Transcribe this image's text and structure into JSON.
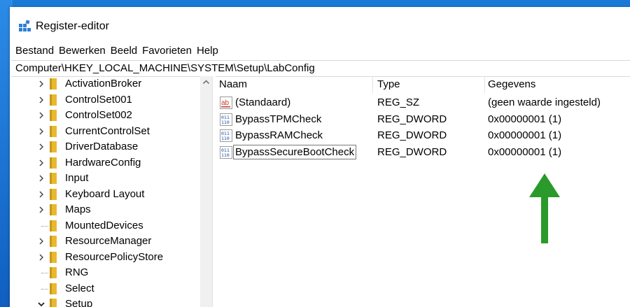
{
  "window": {
    "title": "Register-editor"
  },
  "menu": [
    "Bestand",
    "Bewerken",
    "Beeld",
    "Favorieten",
    "Help"
  ],
  "address": "Computer\\HKEY_LOCAL_MACHINE\\SYSTEM\\Setup\\LabConfig",
  "tree": [
    {
      "label": "ActivationBroker",
      "arrow": "right"
    },
    {
      "label": "ControlSet001",
      "arrow": "right"
    },
    {
      "label": "ControlSet002",
      "arrow": "right"
    },
    {
      "label": "CurrentControlSet",
      "arrow": "right"
    },
    {
      "label": "DriverDatabase",
      "arrow": "right"
    },
    {
      "label": "HardwareConfig",
      "arrow": "right"
    },
    {
      "label": "Input",
      "arrow": "right"
    },
    {
      "label": "Keyboard Layout",
      "arrow": "right"
    },
    {
      "label": "Maps",
      "arrow": "right"
    },
    {
      "label": "MountedDevices",
      "arrow": "none"
    },
    {
      "label": "ResourceManager",
      "arrow": "right"
    },
    {
      "label": "ResourcePolicyStore",
      "arrow": "right"
    },
    {
      "label": "RNG",
      "arrow": "none"
    },
    {
      "label": "Select",
      "arrow": "none"
    },
    {
      "label": "Setup",
      "arrow": "down"
    }
  ],
  "columns": {
    "name": "Naam",
    "type": "Type",
    "data": "Gegevens"
  },
  "values": [
    {
      "icon": "string-value-icon",
      "name": "(Standaard)",
      "type": "REG_SZ",
      "data": "(geen waarde ingesteld)"
    },
    {
      "icon": "binary-value-icon",
      "name": "BypassTPMCheck",
      "type": "REG_DWORD",
      "data": "0x00000001 (1)"
    },
    {
      "icon": "binary-value-icon",
      "name": "BypassRAMCheck",
      "type": "REG_DWORD",
      "data": "0x00000001 (1)"
    },
    {
      "icon": "binary-value-icon",
      "name": "BypassSecureBootCheck",
      "type": "REG_DWORD",
      "data": "0x00000001 (1)",
      "focused": true
    }
  ],
  "colors": {
    "desktop": "#1a78d6",
    "folder": "#e8b930",
    "arrow_annotation": "#2a9a2a"
  }
}
